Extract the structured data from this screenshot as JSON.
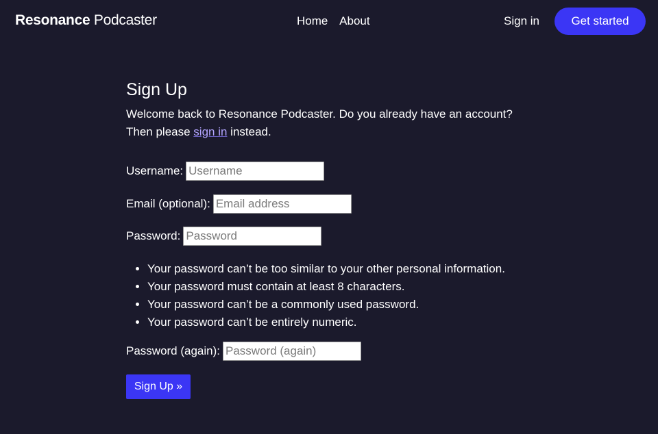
{
  "brand": {
    "bold": "Resonance",
    "light": "Podcaster"
  },
  "nav": {
    "links": [
      "Home",
      "About"
    ],
    "signin": "Sign in",
    "cta": "Get started"
  },
  "page": {
    "title": "Sign Up",
    "intro_before": "Welcome back to Resonance Podcaster. Do you already have an account? Then please ",
    "intro_link": "sign in",
    "intro_after": " instead."
  },
  "form": {
    "username": {
      "label": "Username:",
      "placeholder": "Username"
    },
    "email": {
      "label": "Email (optional):",
      "placeholder": "Email address"
    },
    "password": {
      "label": "Password:",
      "placeholder": "Password"
    },
    "password_rules": [
      "Your password can’t be too similar to your other personal information.",
      "Your password must contain at least 8 characters.",
      "Your password can’t be a commonly used password.",
      "Your password can’t be entirely numeric."
    ],
    "password2": {
      "label": "Password (again):",
      "placeholder": "Password (again)"
    },
    "submit": "Sign Up »"
  },
  "colors": {
    "background": "#1b1a2c",
    "accent": "#3b36f5",
    "link": "#b3a5ff"
  }
}
